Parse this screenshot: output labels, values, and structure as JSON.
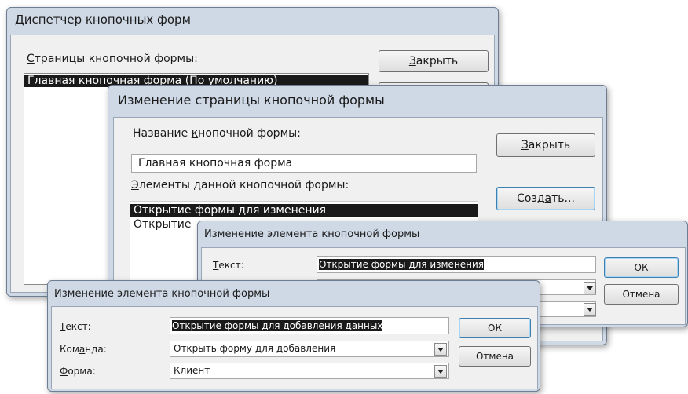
{
  "switchboard_manager": {
    "title": "Диспетчер кнопочных форм",
    "pages_label_prefix": "",
    "pages_label_ul": "С",
    "pages_label_rest": "траницы кнопочной формы:",
    "pages": [
      "Главная кнопочная форма (По умолчанию)"
    ],
    "close_prefix": "",
    "close_ul": "З",
    "close_rest": "акрыть"
  },
  "edit_page": {
    "title": "Изменение страницы кнопочной формы",
    "name_label_prefix": "Название ",
    "name_label_ul": "к",
    "name_label_rest": "нопочной формы:",
    "name_value": "Главная кнопочная форма",
    "items_label_prefix": "",
    "items_label_ul": "Э",
    "items_label_rest": "лементы данной кнопочной формы:",
    "items": [
      "Открытие формы для изменения",
      "Открытие"
    ],
    "close_prefix": "",
    "close_ul": "З",
    "close_rest": "акрыть",
    "create_prefix": "Созд",
    "create_ul": "а",
    "create_rest": "ть..."
  },
  "edit_item_back": {
    "title": "Изменение элемента кнопочной формы",
    "text_label_prefix": "",
    "text_label_ul": "Т",
    "text_label_rest": "екст:",
    "text_value": "Открытие формы для изменения",
    "ok_label": "ОК",
    "cancel_label": "Отмена"
  },
  "edit_item_front": {
    "title": "Изменение элемента кнопочной формы",
    "text_label_prefix": "",
    "text_label_ul": "Т",
    "text_label_rest": "екст:",
    "text_value": "Открытие формы для добавления данных",
    "command_label_prefix": "Ком",
    "command_label_ul": "а",
    "command_label_rest": "нда:",
    "command_value": "Открыть форму для добавления",
    "form_label_prefix": "",
    "form_label_ul": "Ф",
    "form_label_rest": "орма:",
    "form_value": "Клиент",
    "ok_label": "ОК",
    "cancel_label": "Отмена"
  }
}
